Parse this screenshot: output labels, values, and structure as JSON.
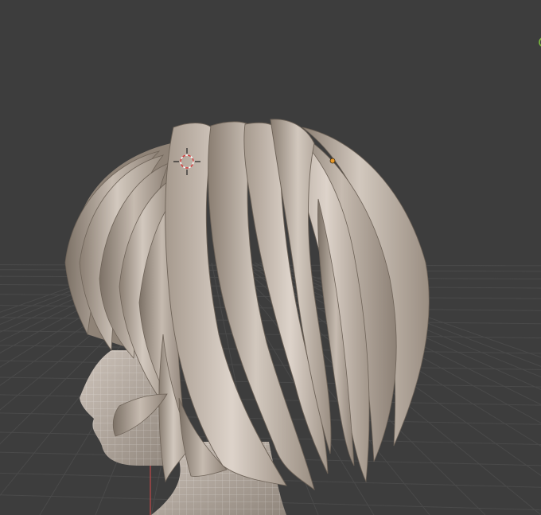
{
  "viewport": {
    "mode": "3d-viewport",
    "shading": "solid",
    "object": "stylized-hair-mesh",
    "head_visible": true,
    "grid_floor_visible": true,
    "colors": {
      "background": "#3d3d3d",
      "grid_line": "#4a4a4a",
      "mesh_base": "#b8aca0",
      "mesh_highlight": "#d6ccc2",
      "mesh_shadow": "#7a6f64",
      "wire": "#ffffff",
      "z_axis": "#c24a4a",
      "origin_dot": "#e89a2a",
      "gizmo": "#7fbf3f"
    },
    "icons": {
      "cursor": "3d-cursor-icon",
      "origin": "origin-dot-icon",
      "gizmo": "axis-gizmo-icon"
    }
  }
}
